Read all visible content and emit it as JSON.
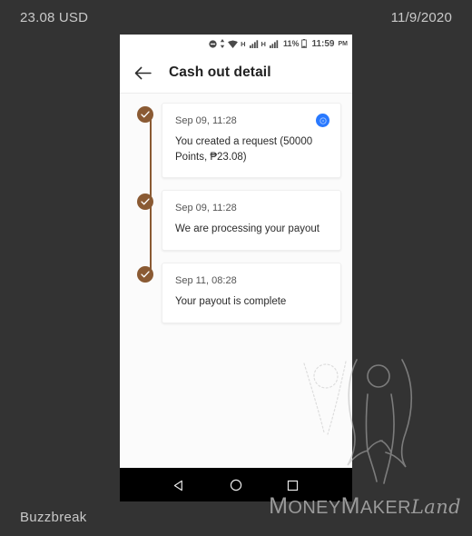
{
  "outer": {
    "amount_label": "23.08 USD",
    "date_label": "11/9/2020",
    "app_name": "Buzzbreak",
    "watermark": {
      "part1": "M",
      "part2": "ONEY",
      "part3": "M",
      "part4": "AKER",
      "part5": "Land",
      "figure_icon": "person-raised-arms-icon"
    },
    "background_color": "#333333"
  },
  "phone": {
    "statusbar": {
      "dnd_icon": "do-not-disturb-icon",
      "sync_icon": "vertical-arrows-icon",
      "wifi_icon": "wifi-icon",
      "signal1_letter": "H",
      "signal1_icon": "signal-bars-icon",
      "signal2_letter": "H",
      "signal2_icon": "signal-bars-icon",
      "battery_percent": "11%",
      "battery_icon": "battery-low-icon",
      "time": "11:59",
      "ampm": "PM"
    },
    "appbar": {
      "back_icon": "back-arrow-icon",
      "title": "Cash out detail"
    },
    "timeline": {
      "accent_color": "#8a5a33",
      "items": [
        {
          "status_icon": "check-circle-icon",
          "date": "Sep 09, 11:28",
          "text": "You created a request (50000 Points, ₱23.08)",
          "badge_icon": "coin-icon",
          "badge_color": "#2979ff",
          "has_badge": true
        },
        {
          "status_icon": "check-circle-icon",
          "date": "Sep 09, 11:28",
          "text": "We are processing your payout",
          "has_badge": false
        },
        {
          "status_icon": "check-circle-icon",
          "date": "Sep 11, 08:28",
          "text": "Your payout is complete",
          "has_badge": false
        }
      ]
    },
    "navbar": {
      "back_icon": "nav-back-triangle-icon",
      "home_icon": "nav-home-circle-icon",
      "recents_icon": "nav-recents-square-icon"
    }
  }
}
